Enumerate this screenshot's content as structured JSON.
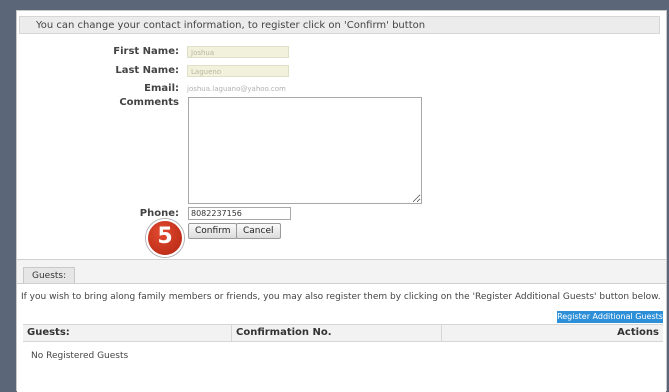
{
  "notice": "You can change your contact information, to register click on 'Confirm' button",
  "form": {
    "first_name_label": "First Name:",
    "first_name_value": "Joshua",
    "last_name_label": "Last Name:",
    "last_name_value": "Lagueno",
    "email_label": "Email:",
    "email_value": "joshua.laguano@yahoo.com",
    "comments_label": "Comments",
    "comments_value": "",
    "phone_label": "Phone:",
    "phone_value": "8082237156",
    "confirm_label": "Confirm",
    "cancel_label": "Cancel",
    "step_badge": "5"
  },
  "guests": {
    "tab_label": "Guests:",
    "hint": "If you wish to bring along family members or friends, you may also register them by clicking on the 'Register Additional Guests' button below.",
    "register_button": "Register Additional Guests",
    "columns": [
      "Guests:",
      "Confirmation No.",
      "Actions"
    ],
    "empty_message": "No Registered Guests"
  },
  "colors": {
    "background": "#5b6778",
    "accent_button": "#2d8fd8",
    "badge": "#c0301a"
  }
}
